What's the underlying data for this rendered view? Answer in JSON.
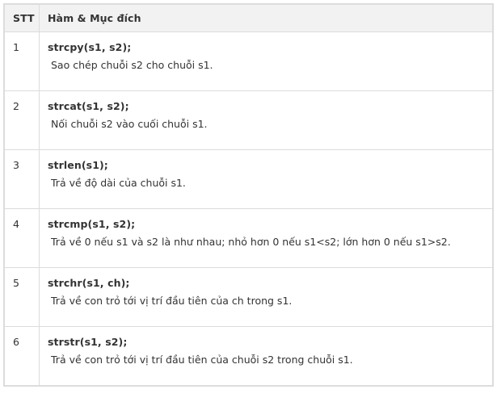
{
  "table": {
    "headers": [
      "STT",
      "Hàm & Mục đích"
    ],
    "rows": [
      {
        "stt": "1",
        "name": "strcpy(s1, s2);",
        "desc": "Sao chép chuỗi s2 cho chuỗi s1."
      },
      {
        "stt": "2",
        "name": "strcat(s1, s2);",
        "desc": "Nối chuỗi s2 vào cuối chuỗi s1."
      },
      {
        "stt": "3",
        "name": "strlen(s1);",
        "desc": "Trả về độ dài của chuỗi s1."
      },
      {
        "stt": "4",
        "name": "strcmp(s1, s2);",
        "desc": "Trả về 0 nếu s1 và s2 là như nhau; nhỏ hơn 0 nếu s1<s2; lớn hơn 0 nếu s1>s2."
      },
      {
        "stt": "5",
        "name": "strchr(s1, ch);",
        "desc": "Trả về con trỏ tới vị trí đầu tiên của ch trong s1."
      },
      {
        "stt": "6",
        "name": "strstr(s1, s2);",
        "desc": "Trả về con trỏ tới vị trí đầu tiên của chuỗi s2 trong chuỗi s1."
      }
    ]
  }
}
